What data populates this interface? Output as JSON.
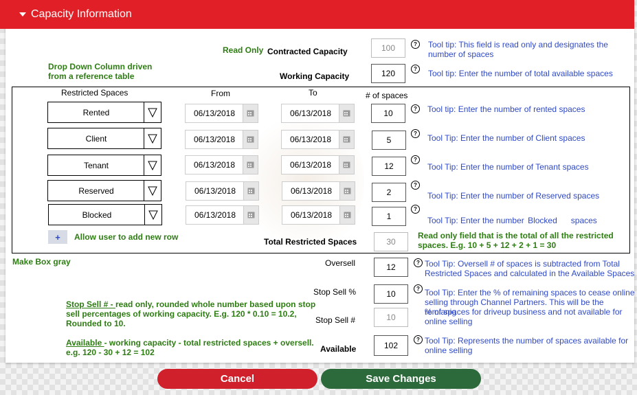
{
  "header": {
    "title": "Capacity Information"
  },
  "notes": {
    "read_only": "Read Only",
    "dropdown_line1": "Drop Down Column driven",
    "dropdown_line2": "from a reference table",
    "make_box_gray": "Make Box gray",
    "total_note_line1": "Read only field that is the total of all the restricted",
    "total_note_line2": "spaces. E.g. 10 + 5 + 12 + 2 + 1 = 30",
    "stop_sell_title": "Stop Sell # - ",
    "stop_sell_line1": "read only, rounded whole number based upon stop",
    "stop_sell_line2": "sell percentages of working capacity. E.g. 120 * 0.10 = 10.2,",
    "stop_sell_line3": "Rounded to 10.",
    "available_title": "Available ",
    "available_line1": "- working capacity - total restricted spaces + oversell.",
    "available_line2": "e.g. 120 - 30 + 12 = 102"
  },
  "fields": {
    "contracted_capacity": {
      "label": "Contracted Capacity",
      "value": "100",
      "tooltip_line1": "Tool tip: This field is read only and designates the",
      "tooltip_line2": "number of spaces"
    },
    "working_capacity": {
      "label": "Working Capacity",
      "value": "120",
      "tooltip": "Tool tip: Enter the number of total available spaces"
    },
    "total_restricted": {
      "label_bold": "Total ",
      "label": "Restricted Spaces",
      "value": "30"
    },
    "oversell": {
      "label": "Oversell",
      "value": "12",
      "tooltip_line1": "Tool Tip: Oversell # of spaces is subtracted from Total",
      "tooltip_line2": "Restricted Spaces and calculated in the Available Spaces"
    },
    "stop_sell_pct": {
      "label": "Stop Sell %",
      "value": "10",
      "tooltip_line1": "Tool Tip: Enter the % of remaining spaces to cease online",
      "tooltip_line2": "selling through Channel Partners. This will be the remianig",
      "tooltip_line3": "% of spaces for driveup business and not available for",
      "tooltip_line4": "online selling"
    },
    "stop_sell_num": {
      "label": "Stop Sell #",
      "value": "10"
    },
    "available": {
      "label": "Available",
      "value": "102",
      "tooltip_line1": "Tool Tip: Represents the number of spaces available for",
      "tooltip_line2": "online selling"
    }
  },
  "table": {
    "headers": {
      "restricted": "Restricted Spaces",
      "from": "From",
      "to": "To",
      "count": "# of spaces"
    },
    "rows": [
      {
        "type": "Rented",
        "from": "06/13/2018",
        "to": "06/13/2018",
        "count": "10",
        "tooltip": "Tool tip: Enter the number of rented spaces"
      },
      {
        "type": "Client",
        "from": "06/13/2018",
        "to": "06/13/2018",
        "count": "5",
        "tooltip": "Tool Tip: Enter the number of Client spaces"
      },
      {
        "type": "Tenant",
        "from": "06/13/2018",
        "to": "06/13/2018",
        "count": "12",
        "tooltip": "Tool Tip: Enter the number of Tenant spaces"
      },
      {
        "type": "Reserved",
        "from": "06/13/2018",
        "to": "06/13/2018",
        "count": "2",
        "tooltip": "Tool Tip: Enter the number of Reserved spaces"
      },
      {
        "type": "Blocked",
        "from": "06/13/2018",
        "to": "06/13/2018",
        "count": "1",
        "tooltip": "Tool Tip: Enter the number ",
        "tooltip_insert": "Blocked",
        "tooltip_end": "spaces"
      }
    ],
    "add_row_icon": "+",
    "add_row_label": "Allow user to add new row"
  },
  "help_icon": "?",
  "footer": {
    "cancel": "Cancel",
    "save": "Save Changes"
  },
  "colors": {
    "header": "#e11f26",
    "cancel": "#d0202b",
    "save": "#2c6a3c",
    "note_green": "#2e7d13",
    "tooltip_blue": "#2f49c4"
  }
}
